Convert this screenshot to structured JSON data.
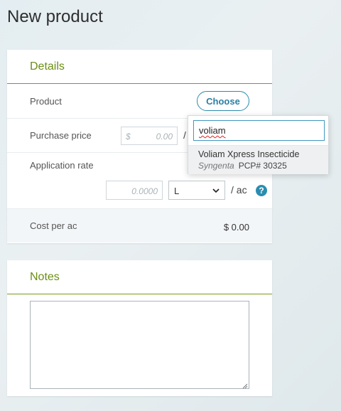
{
  "page": {
    "title": "New product"
  },
  "details": {
    "title": "Details",
    "product_label": "Product",
    "choose_label": "Choose",
    "purchase_price_label": "Purchase price",
    "price_currency": "$",
    "price_placeholder": "0.00",
    "price_slash": "/",
    "application_rate_label": "Application rate",
    "rate_placeholder": "0.0000",
    "unit_selected": "L",
    "per_unit": "/  ac",
    "help_glyph": "?",
    "cost_label": "Cost per ac",
    "cost_value": "$ 0.00"
  },
  "notes": {
    "title": "Notes",
    "value": ""
  },
  "product_search": {
    "query": "voliam",
    "results": [
      {
        "name": "Voliam Xpress Insecticide",
        "brand": "Syngenta",
        "pcp": "PCP# 30325"
      }
    ]
  },
  "icons": {
    "unit_chevron": "chevron-down-icon",
    "help": "help-icon",
    "resize": "resize-grip-icon"
  },
  "colors": {
    "accent_green": "#6a8e12",
    "accent_blue": "#2a8db0"
  }
}
